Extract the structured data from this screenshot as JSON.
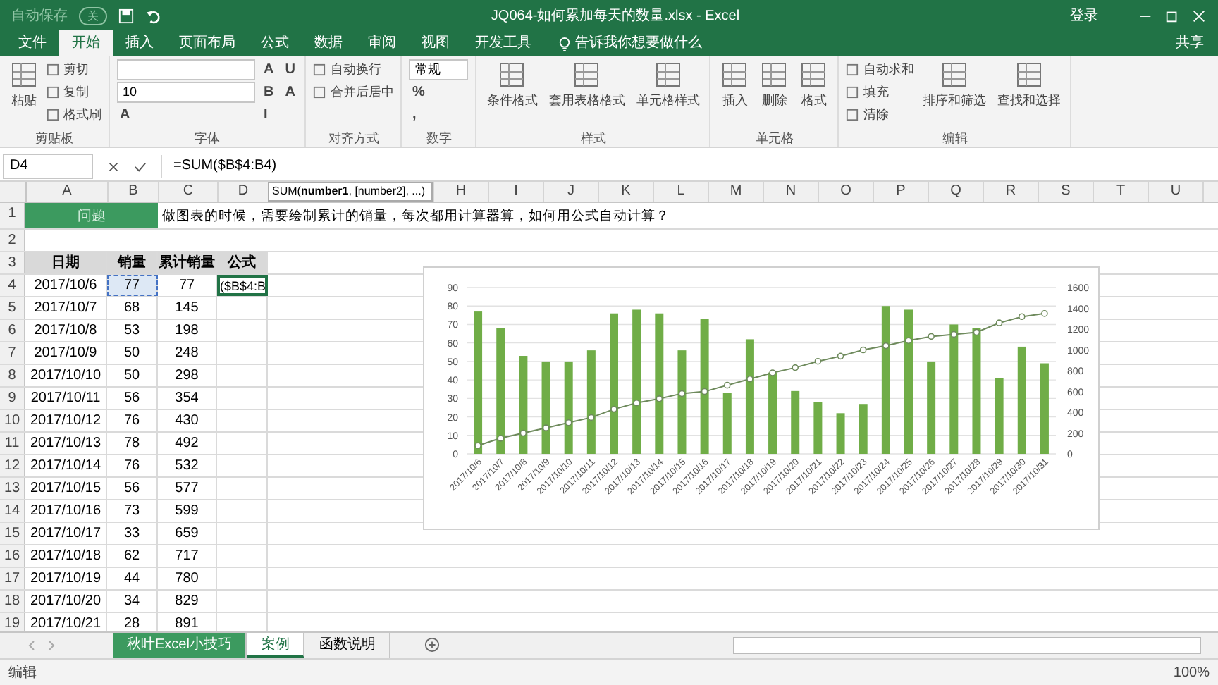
{
  "title_bar": {
    "autosave": "自动保存",
    "autosave_state": "关",
    "title": "JQ064-如何累加每天的数量.xlsx  -  Excel",
    "signin": "登录"
  },
  "tabs": [
    {
      "label": "文件",
      "selected": false
    },
    {
      "label": "开始",
      "selected": true
    },
    {
      "label": "插入",
      "selected": false
    },
    {
      "label": "页面布局",
      "selected": false
    },
    {
      "label": "公式",
      "selected": false
    },
    {
      "label": "数据",
      "selected": false
    },
    {
      "label": "审阅",
      "selected": false
    },
    {
      "label": "视图",
      "selected": false
    },
    {
      "label": "开发工具",
      "selected": false
    }
  ],
  "tell_me": "告诉我你想要做什么",
  "share": "共享",
  "ribbon": [
    {
      "label": "剪贴板",
      "items": [
        {
          "kind": "large",
          "text": "粘贴"
        },
        {
          "kind": "small",
          "text": "剪切"
        },
        {
          "kind": "small",
          "text": "复制"
        },
        {
          "kind": "small",
          "text": "格式刷"
        }
      ]
    },
    {
      "label": "字体",
      "items": [
        {
          "kind": "field"
        },
        {
          "kind": "field",
          "text": "10"
        },
        {
          "kind": "glyph",
          "text": "A"
        },
        {
          "kind": "glyph",
          "text": "A"
        },
        {
          "kind": "glyph",
          "text": "B"
        },
        {
          "kind": "glyph",
          "text": "I"
        },
        {
          "kind": "glyph",
          "text": "U"
        },
        {
          "kind": "glyph",
          "text": "A"
        }
      ]
    },
    {
      "label": "对齐方式",
      "items": [
        {
          "kind": "small",
          "text": "自动换行"
        },
        {
          "kind": "small",
          "text": "合并后居中"
        }
      ]
    },
    {
      "label": "数字",
      "items": [
        {
          "kind": "field",
          "text": "常规"
        },
        {
          "kind": "glyph",
          "text": "%"
        },
        {
          "kind": "glyph",
          "text": ","
        }
      ]
    },
    {
      "label": "样式",
      "items": [
        {
          "kind": "large",
          "text": "条件格式"
        },
        {
          "kind": "large",
          "text": "套用表格格式"
        },
        {
          "kind": "large",
          "text": "单元格样式"
        }
      ]
    },
    {
      "label": "单元格",
      "items": [
        {
          "kind": "large",
          "text": "插入"
        },
        {
          "kind": "large",
          "text": "删除"
        },
        {
          "kind": "large",
          "text": "格式"
        }
      ]
    },
    {
      "label": "编辑",
      "items": [
        {
          "kind": "small",
          "text": "自动求和"
        },
        {
          "kind": "small",
          "text": "填充"
        },
        {
          "kind": "small",
          "text": "清除"
        },
        {
          "kind": "large",
          "text": "排序和筛选"
        },
        {
          "kind": "large",
          "text": "查找和选择"
        }
      ]
    }
  ],
  "formula_bar": {
    "name_box": "D4",
    "formula": "=SUM($B$4:B4)",
    "tooltip": "SUM(**number1**, [number2], ...)"
  },
  "columns": [
    "A",
    "B",
    "C",
    "D",
    "H",
    "I",
    "J",
    "K",
    "L",
    "M",
    "N",
    "O",
    "P",
    "Q",
    "R",
    "S",
    "T",
    "U"
  ],
  "question": {
    "row": "1",
    "label": "问题",
    "text": "做图表的时候，需要绘制累计的销量，每次都用计算器算，如何用公式自动计算？"
  },
  "blank_row": "2",
  "header_row": {
    "row": "3",
    "cells": [
      "日期",
      "销量",
      "累计销量",
      "公式"
    ]
  },
  "rows": [
    {
      "row": "4",
      "cells": [
        {
          "text": "2017/10/6",
          "active": false,
          "referenced": false
        },
        {
          "text": "77",
          "active": false,
          "referenced": true
        },
        {
          "text": "77",
          "active": false,
          "referenced": false
        },
        {
          "text": "($B$4:B",
          "active": true,
          "referenced": false
        }
      ]
    },
    {
      "row": "5",
      "cells": [
        {
          "text": "2017/10/7",
          "active": false,
          "referenced": false
        },
        {
          "text": "68",
          "active": false,
          "referenced": false
        },
        {
          "text": "145",
          "active": false,
          "referenced": false
        }
      ]
    },
    {
      "row": "6",
      "cells": [
        {
          "text": "2017/10/8",
          "active": false,
          "referenced": false
        },
        {
          "text": "53",
          "active": false,
          "referenced": false
        },
        {
          "text": "198",
          "active": false,
          "referenced": false
        }
      ]
    },
    {
      "row": "7",
      "cells": [
        {
          "text": "2017/10/9",
          "active": false,
          "referenced": false
        },
        {
          "text": "50",
          "active": false,
          "referenced": false
        },
        {
          "text": "248",
          "active": false,
          "referenced": false
        }
      ]
    },
    {
      "row": "8",
      "cells": [
        {
          "text": "2017/10/10",
          "active": false,
          "referenced": false
        },
        {
          "text": "50",
          "active": false,
          "referenced": false
        },
        {
          "text": "298",
          "active": false,
          "referenced": false
        }
      ]
    },
    {
      "row": "9",
      "cells": [
        {
          "text": "2017/10/11",
          "active": false,
          "referenced": false
        },
        {
          "text": "56",
          "active": false,
          "referenced": false
        },
        {
          "text": "354",
          "active": false,
          "referenced": false
        }
      ]
    },
    {
      "row": "10",
      "cells": [
        {
          "text": "2017/10/12",
          "active": false,
          "referenced": false
        },
        {
          "text": "76",
          "active": false,
          "referenced": false
        },
        {
          "text": "430",
          "active": false,
          "referenced": false
        }
      ]
    },
    {
      "row": "11",
      "cells": [
        {
          "text": "2017/10/13",
          "active": false,
          "referenced": false
        },
        {
          "text": "78",
          "active": false,
          "referenced": false
        },
        {
          "text": "492",
          "active": false,
          "referenced": false
        }
      ]
    },
    {
      "row": "12",
      "cells": [
        {
          "text": "2017/10/14",
          "active": false,
          "referenced": false
        },
        {
          "text": "76",
          "active": false,
          "referenced": false
        },
        {
          "text": "532",
          "active": false,
          "referenced": false
        }
      ]
    },
    {
      "row": "13",
      "cells": [
        {
          "text": "2017/10/15",
          "active": false,
          "referenced": false
        },
        {
          "text": "56",
          "active": false,
          "referenced": false
        },
        {
          "text": "577",
          "active": false,
          "referenced": false
        }
      ]
    },
    {
      "row": "14",
      "cells": [
        {
          "text": "2017/10/16",
          "active": false,
          "referenced": false
        },
        {
          "text": "73",
          "active": false,
          "referenced": false
        },
        {
          "text": "599",
          "active": false,
          "referenced": false
        }
      ]
    },
    {
      "row": "15",
      "cells": [
        {
          "text": "2017/10/17",
          "active": false,
          "referenced": false
        },
        {
          "text": "33",
          "active": false,
          "referenced": false
        },
        {
          "text": "659",
          "active": false,
          "referenced": false
        }
      ]
    },
    {
      "row": "16",
      "cells": [
        {
          "text": "2017/10/18",
          "active": false,
          "referenced": false
        },
        {
          "text": "62",
          "active": false,
          "referenced": false
        },
        {
          "text": "717",
          "active": false,
          "referenced": false
        }
      ]
    },
    {
      "row": "17",
      "cells": [
        {
          "text": "2017/10/19",
          "active": false,
          "referenced": false
        },
        {
          "text": "44",
          "active": false,
          "referenced": false
        },
        {
          "text": "780",
          "active": false,
          "referenced": false
        }
      ]
    },
    {
      "row": "18",
      "cells": [
        {
          "text": "2017/10/20",
          "active": false,
          "referenced": false
        },
        {
          "text": "34",
          "active": false,
          "referenced": false
        },
        {
          "text": "829",
          "active": false,
          "referenced": false
        }
      ]
    },
    {
      "row": "19",
      "cells": [
        {
          "text": "2017/10/21",
          "active": false,
          "referenced": false
        },
        {
          "text": "28",
          "active": false,
          "referenced": false
        },
        {
          "text": "891",
          "active": false,
          "referenced": false
        }
      ]
    }
  ],
  "chart": {
    "chart_data": {
      "type": "bar",
      "categories": [
        "2017/10/6",
        "2017/10/7",
        "2017/10/8",
        "2017/10/9",
        "2017/10/10",
        "2017/10/11",
        "2017/10/12",
        "2017/10/13",
        "2017/10/14",
        "2017/10/15",
        "2017/10/16",
        "2017/10/17",
        "2017/10/18",
        "2017/10/19",
        "2017/10/20",
        "2017/10/21",
        "2017/10/22",
        "2017/10/23",
        "2017/10/24",
        "2017/10/25",
        "2017/10/26",
        "2017/10/27",
        "2017/10/28",
        "2017/10/29",
        "2017/10/30",
        "2017/10/31"
      ],
      "series": [
        {
          "color": "#70ad47",
          "values": [
            77,
            68,
            53,
            50,
            50,
            56,
            76,
            78,
            76,
            56,
            73,
            33,
            62,
            44,
            34,
            28,
            22,
            27,
            80,
            78,
            50,
            70,
            68,
            41,
            58,
            49
          ]
        },
        {
          "color": "#6e8a5c",
          "type": "line",
          "axis": "y2",
          "marker": true,
          "values": [
            80,
            150,
            200,
            250,
            300,
            350,
            430,
            490,
            530,
            580,
            600,
            660,
            720,
            780,
            830,
            890,
            940,
            1000,
            1040,
            1090,
            1130,
            1150,
            1170,
            1260,
            1320,
            1350
          ]
        }
      ],
      "grid": true,
      "ylim": [
        0,
        90
      ],
      "yticks": [
        0,
        10,
        20,
        30,
        40,
        50,
        60,
        70,
        80,
        90
      ],
      "y2lim": [
        0,
        1600
      ],
      "y2ticks": [
        0,
        200,
        400,
        600,
        800,
        1000,
        1200,
        1400,
        1600
      ]
    }
  },
  "sheet_tabs": [
    {
      "label": "秋叶Excel小技巧",
      "selected": false,
      "color": "#3c9a5f"
    },
    {
      "label": "案例",
      "selected": true
    },
    {
      "label": "函数说明",
      "selected": false
    }
  ],
  "status": {
    "mode": "编辑",
    "zoom": "100%"
  }
}
